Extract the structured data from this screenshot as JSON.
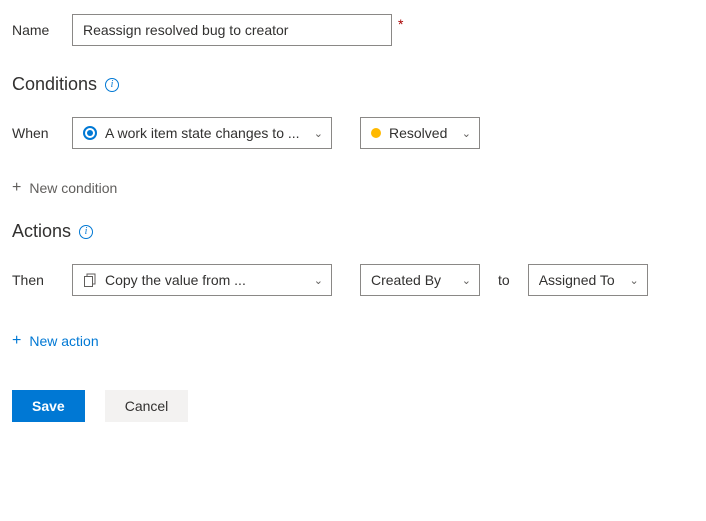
{
  "name_field": {
    "label": "Name",
    "value": "Reassign resolved bug to creator"
  },
  "conditions": {
    "heading": "Conditions",
    "when_label": "When",
    "trigger_value": "A work item state changes to ...",
    "state_value": "Resolved",
    "add_label": "New condition"
  },
  "actions": {
    "heading": "Actions",
    "then_label": "Then",
    "action_value": "Copy the value from ...",
    "from_field": "Created By",
    "to_label": "to",
    "to_field": "Assigned To",
    "add_label": "New action"
  },
  "footer": {
    "save": "Save",
    "cancel": "Cancel"
  }
}
